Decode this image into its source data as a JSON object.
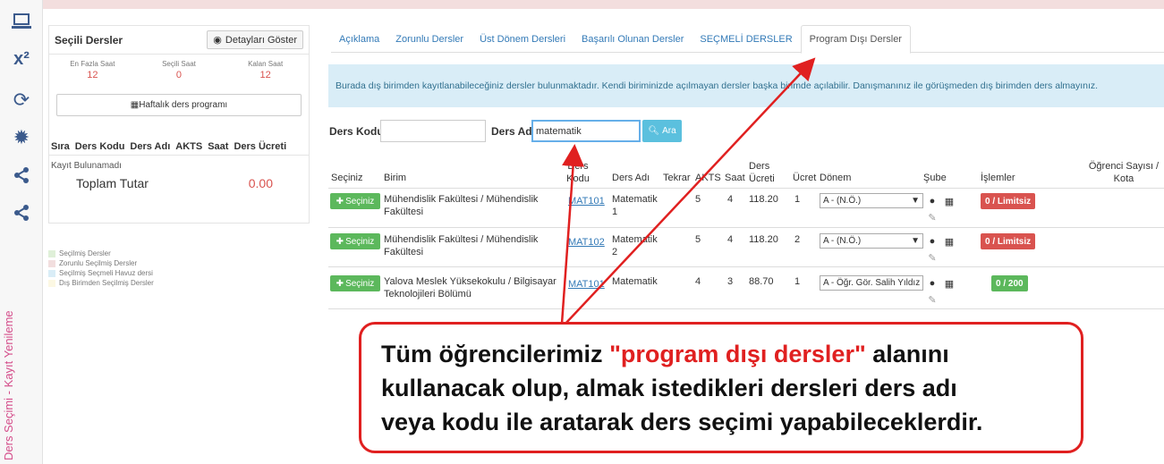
{
  "sidebar": {
    "icons": [
      "laptop-icon",
      "superscript-icon",
      "refresh-icon",
      "gear-icon",
      "share-icon",
      "share-icon"
    ],
    "vertical_label": "Ders Seçimi - Kayıt Yenileme"
  },
  "left_panel": {
    "title": "Seçili Dersler",
    "detail_button": "Detayları Göster",
    "stats": [
      {
        "label": "En Fazla Saat",
        "value": "12"
      },
      {
        "label": "Seçili Saat",
        "value": "0"
      },
      {
        "label": "Kalan Saat",
        "value": "12"
      }
    ],
    "weekly_button": "Haftalık ders programı",
    "columns": [
      "Sıra",
      "Ders Kodu",
      "Ders Adı",
      "AKTS",
      "Saat",
      "Ders Ücreti"
    ],
    "no_record": "Kayıt Bulunamadı",
    "total_label": "Toplam Tutar",
    "total_value": "0.00"
  },
  "legend": [
    {
      "label": "Seçilmiş Dersler",
      "color": "#dff0d8"
    },
    {
      "label": "Zorunlu Seçilmiş Dersler",
      "color": "#f2dede"
    },
    {
      "label": "Seçilmiş Seçmeli Havuz dersi",
      "color": "#d9edf7"
    },
    {
      "label": "Dış Birimden Seçilmiş Dersler",
      "color": "#fcf8e3"
    }
  ],
  "tabs": [
    {
      "label": "Açıklama"
    },
    {
      "label": "Zorunlu Dersler"
    },
    {
      "label": "Üst Dönem Dersleri"
    },
    {
      "label": "Başarılı Olunan Dersler"
    },
    {
      "label": "SEÇMELİ DERSLER"
    },
    {
      "label": "Program Dışı Dersler",
      "active": true
    }
  ],
  "info_text": "Burada dış birimden kayıtlanabileceğiniz dersler bulunmaktadır. Kendi biriminizde açılmayan dersler başka birimde açılabilir. Danışmanınız ile görüşmeden dış birimden ders almayınız.",
  "search": {
    "code_label": "Ders Kodu",
    "code_value": "",
    "name_label": "Ders Adı",
    "name_value": "matematik",
    "button": "Ara"
  },
  "table": {
    "headers": {
      "seciniz": "Seçiniz",
      "birim": "Birim",
      "ders_kodu": "Ders Kodu",
      "ders_adi": "Ders Adı",
      "tekrar": "Tekrar",
      "akts": "AKTS",
      "saat": "Saat",
      "ders_ucreti": "Ders Ücreti",
      "ucret": "Ücret",
      "donem": "Dönem",
      "sube": "Şube",
      "islemler": "İşlemler",
      "ogrenci": "Öğrenci Sayısı / Kota"
    },
    "select_label": "Seçiniz",
    "rows": [
      {
        "birim": "Mühendislik Fakültesi / Mühendislik Fakültesi",
        "kodu": "MAT101",
        "adi": "Matematik 1",
        "akts": "5",
        "saat": "4",
        "ucreti": "118.20",
        "ucret": "1",
        "donem": "A - (N.Ö.)",
        "kota": "0 / Limitsiz",
        "kota_color": "red"
      },
      {
        "birim": "Mühendislik Fakültesi / Mühendislik Fakültesi",
        "kodu": "MAT102",
        "adi": "Matematik 2",
        "akts": "5",
        "saat": "4",
        "ucreti": "118.20",
        "ucret": "2",
        "donem": "A - (N.Ö.)",
        "kota": "0 / Limitsiz",
        "kota_color": "red"
      },
      {
        "birim": "Yalova Meslek Yüksekokulu / Bilgisayar Teknolojileri Bölümü",
        "kodu": "MAT101",
        "adi": "Matematik",
        "akts": "4",
        "saat": "3",
        "ucreti": "88.70",
        "ucret": "1",
        "donem": "A - Öğr. Gör. Salih Yıldız (N.Ö..İ.Ö",
        "kota": "0 / 200",
        "kota_color": "green"
      }
    ]
  },
  "callout": {
    "line1_a": "Tüm öğrencilerimiz ",
    "line1_b": "\"program dışı dersler\"",
    "line1_c": " alanını",
    "line2": "kullanacak olup, almak istedikleri dersleri ders adı",
    "line3": "veya kodu ile aratarak ders seçimi yapabileceklerdir."
  },
  "colors": {
    "annotation": "#e02020",
    "accent": "#337ab7",
    "success": "#5cb85c",
    "danger": "#d9534f",
    "info_bg": "#d9edf7"
  }
}
